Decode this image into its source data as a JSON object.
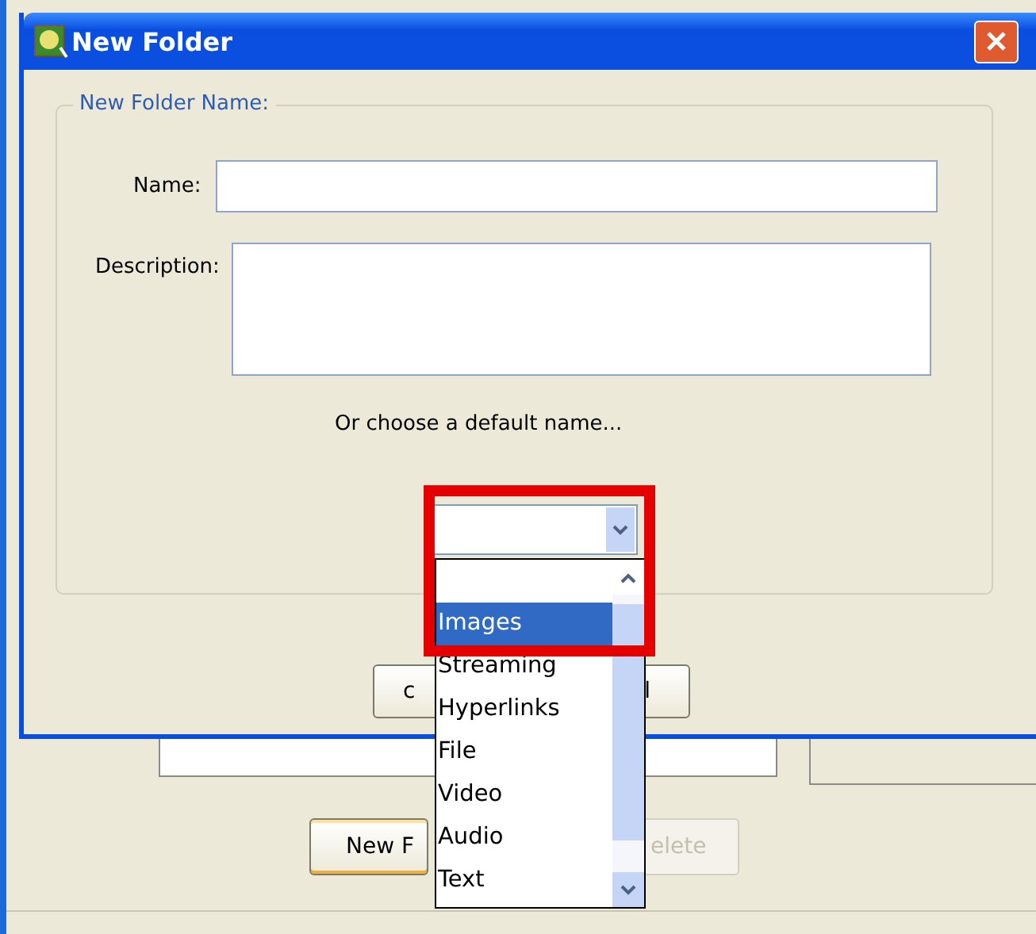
{
  "background_window": {
    "buttons": [
      {
        "label": "New F",
        "disabled": false
      },
      {
        "label": "elete",
        "disabled": true
      }
    ]
  },
  "dialog": {
    "title": "New Folder",
    "group_title": "New Folder Name:",
    "name_label": "Name:",
    "description_label": "Description:",
    "default_name_label": "Or choose a default name...",
    "hidden_button": {
      "left_text": "c",
      "right_text": "l"
    }
  },
  "dropdown": {
    "items": [
      {
        "label": "Images",
        "selected": true
      },
      {
        "label": "Streaming",
        "selected": false
      },
      {
        "label": "Hyperlinks",
        "selected": false
      },
      {
        "label": "File",
        "selected": false
      },
      {
        "label": "Video",
        "selected": false
      },
      {
        "label": "Audio",
        "selected": false
      },
      {
        "label": "Text",
        "selected": false
      }
    ]
  }
}
